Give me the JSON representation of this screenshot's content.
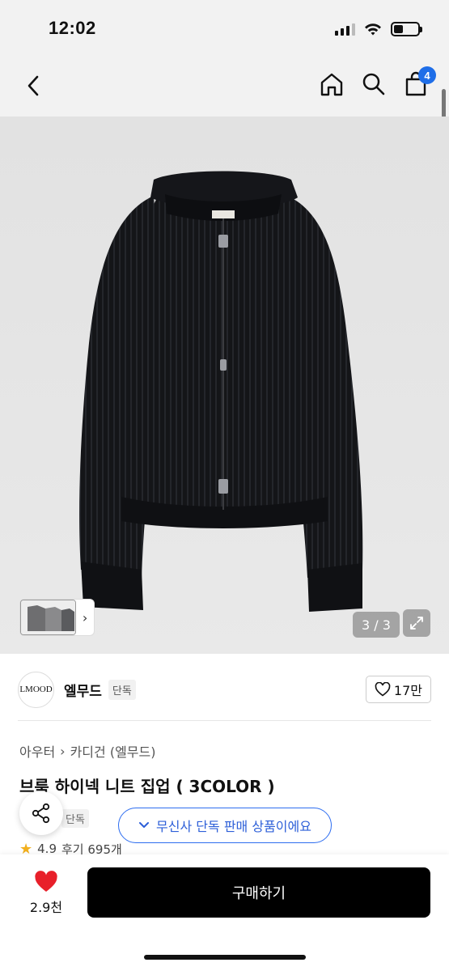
{
  "status_bar": {
    "time": "12:02"
  },
  "nav": {
    "back_icon": "chevron-left-icon",
    "home_icon": "home-icon",
    "search_icon": "search-icon",
    "cart_icon": "cart-icon",
    "cart_count": "4",
    "badge_color": "#1f6ee8"
  },
  "gallery": {
    "counter": "3 / 3",
    "expand_icon": "expand-icon",
    "thumbnail_icon": "chevron-right-icon"
  },
  "brand": {
    "logo_text": "LMOOD",
    "name": "엘무드",
    "tag": "단독",
    "likes": "17만"
  },
  "product": {
    "breadcrumb": [
      "아우터",
      "카디건 (엘무드)"
    ],
    "title": "브룩 하이넥 니트 집업 ( 3COLOR )",
    "exclusive_chip": "단독",
    "musinsa_notice": "무신사 단독 판매 상품이에요",
    "rating": "4.9",
    "reviews": "후기 695개"
  },
  "bottom_bar": {
    "wish_count": "2.9천",
    "buy_label": "구매하기",
    "heart_color": "#e8202a"
  }
}
